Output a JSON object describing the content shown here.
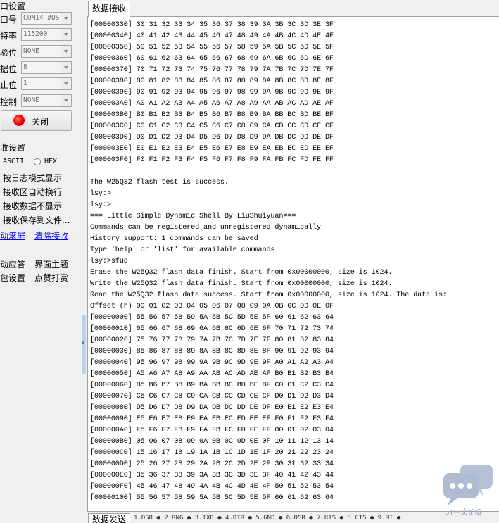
{
  "serial_settings": {
    "group_title": "口设置",
    "fields": [
      {
        "label": "口号",
        "value": "COM14 #US"
      },
      {
        "label": "特率",
        "value": "115200"
      },
      {
        "label": "验位",
        "value": "NONE"
      },
      {
        "label": "据位",
        "value": "8"
      },
      {
        "label": "止位",
        "value": "1"
      },
      {
        "label": "控制",
        "value": "NONE"
      }
    ],
    "open_button": "关闭",
    "led_color": "#e00000"
  },
  "recv_settings": {
    "group_title": "收设置",
    "ascii_label": "ASCII",
    "hex_label": "HEX",
    "options": [
      "按日志模式显示",
      "接收区自动换行",
      "接收数据不显示",
      "接收保存到文件..."
    ],
    "auto_scroll": "动滚屏",
    "clear_recv": "清除接收"
  },
  "misc": {
    "row1_left": "动应答",
    "row1_right": "界面主题",
    "row2_left": "包设置",
    "row2_right": "点赞打赏"
  },
  "recv_tab": "数据接收",
  "recv_lines": [
    "[00000330] 30 31 32 33 34 35 36 37 38 39 3A 3B 3C 3D 3E 3F",
    "[00000340] 40 41 42 43 44 45 46 47 48 49 4A 4B 4C 4D 4E 4F",
    "[00000350] 50 51 52 53 54 55 56 57 58 59 5A 5B 5C 5D 5E 5F",
    "[00000360] 60 61 62 63 64 65 66 67 68 69 6A 6B 6C 6D 6E 6F",
    "[00000370] 70 71 72 73 74 75 76 77 78 79 7A 7B 7C 7D 7E 7F",
    "[00000380] 80 81 82 83 84 85 86 87 88 89 8A 8B 8C 8D 8E 8F",
    "[00000390] 90 91 92 93 94 95 96 97 98 99 9A 9B 9C 9D 9E 9F",
    "[000003A0] A0 A1 A2 A3 A4 A5 A6 A7 A8 A9 AA AB AC AD AE AF",
    "[000003B0] B0 B1 B2 B3 B4 B5 B6 B7 B8 B9 BA BB BC BD BE BF",
    "[000003C0] C0 C1 C2 C3 C4 C5 C6 C7 C8 C9 CA CB CC CD CE CF",
    "[000003D0] D0 D1 D2 D3 D4 D5 D6 D7 D8 D9 DA DB DC DD DE DF",
    "[000003E0] E0 E1 E2 E3 E4 E5 E6 E7 E8 E9 EA EB EC ED EE EF",
    "[000003F0] F0 F1 F2 F3 F4 F5 F6 F7 F8 F9 FA FB FC FD FE FF",
    "",
    "The W25Q32 flash test is success.",
    "lsy:>",
    "lsy:>",
    "=== Little Simple Dynamic Shell By LiuShuiyuan===",
    "Commands can be registered and unregistered dynamically",
    "History support: 1 commands can be saved",
    "Type 'help' or 'list' for available commands",
    "lsy:>sfud",
    "Erase the W25Q32 flash data finish. Start from 0x00000000, size is 1024.",
    "Write the W25Q32 flash data finish. Start from 0x00000000, size is 1024.",
    "Read the W25Q32 flash data success. Start from 0x00000000, size is 1024. The data is:",
    "Offset (h) 00 01 02 03 04 05 06 07 08 09 0A 0B 0C 0D 0E 0F",
    "[00000000] 55 56 57 58 59 5A 5B 5C 5D 5E 5F 60 61 62 63 64",
    "[00000010] 65 66 67 68 69 6A 6B 6C 6D 6E 6F 70 71 72 73 74",
    "[00000020] 75 76 77 78 79 7A 7B 7C 7D 7E 7F 80 81 82 83 84",
    "[00000030] 85 86 87 88 89 8A 8B 8C 8D 8E 8F 90 91 92 93 94",
    "[00000040] 95 96 97 98 99 9A 9B 9C 9D 9E 9F A0 A1 A2 A3 A4",
    "[00000050] A5 A6 A7 A8 A9 AA AB AC AD AE AF B0 B1 B2 B3 B4",
    "[00000060] B5 B6 B7 B8 B9 BA BB BC BD BE BF C0 C1 C2 C3 C4",
    "[00000070] C5 C6 C7 C8 C9 CA CB CC CD CE CF D0 D1 D2 D3 D4",
    "[00000080] D5 D6 D7 D8 D9 DA DB DC DD DE DF E0 E1 E2 E3 E4",
    "[00000090] E5 E6 E7 E8 E9 EA EB EC ED EE EF F0 F1 F2 F3 F4",
    "[000000A0] F5 F6 F7 F8 F9 FA FB FC FD FE FF 00 01 02 03 04",
    "[000000B0] 05 06 07 08 09 0A 0B 0C 0D 0E 0F 10 11 12 13 14",
    "[000000C0] 15 16 17 18 19 1A 1B 1C 1D 1E 1F 20 21 22 23 24",
    "[000000D0] 25 26 27 28 29 2A 2B 2C 2D 2E 2F 30 31 32 33 34",
    "[000000E0] 35 36 37 38 39 3A 3B 3C 3D 3E 3F 40 41 42 43 44",
    "[000000F0] 45 46 47 48 49 4A 4B 4C 4D 4E 4F 50 51 52 53 54",
    "[00000100] 55 56 57 58 59 5A 5B 5C 5D 5E 5F 60 61 62 63 64"
  ],
  "send_tab": "数据发送",
  "send_ports": "1.DSR ● 2.RNG ● 3.TXD ● 4.DTR ● 5.GND ● 6.DSR ● 7.RTS ● 8.CTS ● 9.RI ●",
  "watermark": "ST中文论坛"
}
